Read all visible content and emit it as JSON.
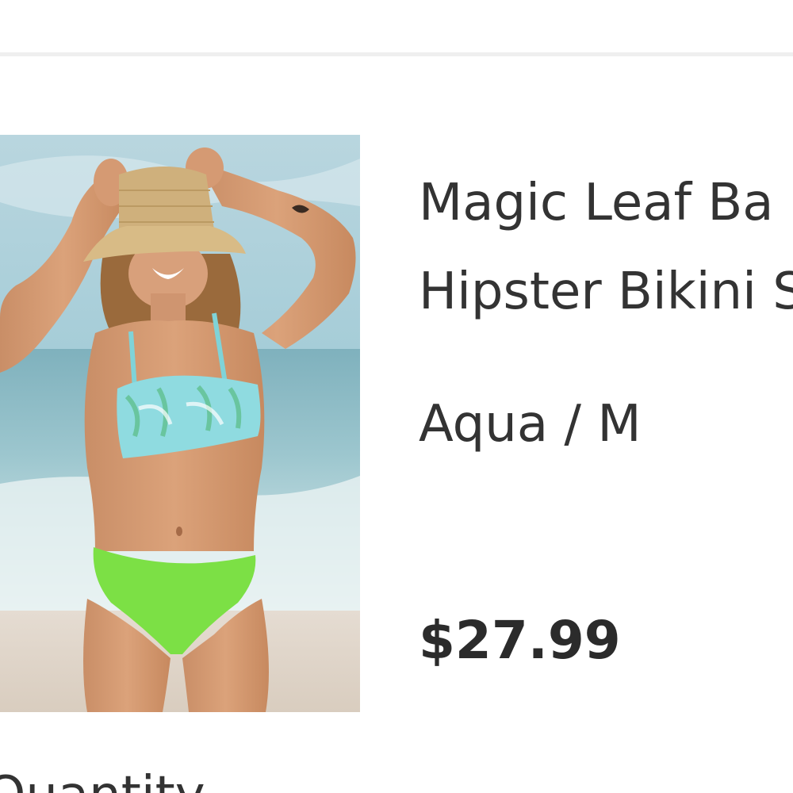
{
  "product": {
    "title_line1": "Magic Leaf Ba",
    "title_line2": "Hipster Bikini S",
    "variant": "Aqua / M",
    "price": "$27.99",
    "image_alt": "Woman in aqua leaf-print bikini top and lime green bottoms on the beach, wearing a straw hat"
  },
  "quantity": {
    "label": "Quantity"
  },
  "colors": {
    "text": "#333333",
    "divider": "#efefef",
    "background": "#ffffff"
  }
}
